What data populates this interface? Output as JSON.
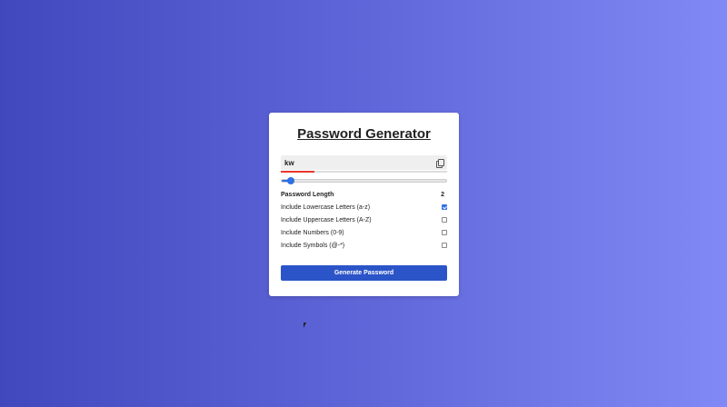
{
  "title": "Password Generator",
  "password": "kw",
  "strength_percent": 20,
  "length": {
    "label": "Password Length",
    "value": "2",
    "fraction": 0.04
  },
  "options": [
    {
      "label": "Include Lowercase Letters (a-z)",
      "checked": true
    },
    {
      "label": "Include Uppercase Letters (A-Z)",
      "checked": false
    },
    {
      "label": "Include Numbers (0-9)",
      "checked": false
    },
    {
      "label": "Include Symbols (@-*)",
      "checked": false
    }
  ],
  "generate_label": "Generate Password",
  "colors": {
    "accent": "#2b54c8",
    "strength": "#e8372b"
  }
}
